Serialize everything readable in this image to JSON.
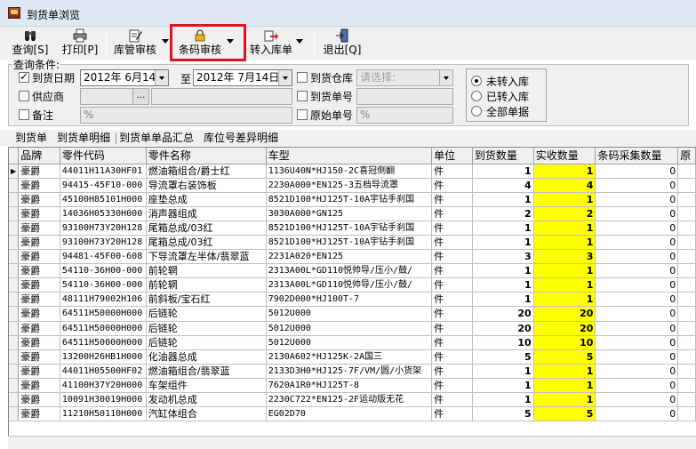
{
  "window": {
    "title": "到货单浏览"
  },
  "toolbar": {
    "query": "查询[S]",
    "print": "打印[P]",
    "warehouse_review": "库管审核",
    "barcode_review": "条码审核",
    "stock_in": "转入库单",
    "exit": "退出[Q]"
  },
  "filter": {
    "legend": "查询条件:",
    "arrival_date_label": "到货日期",
    "date_from": "2012年 6月14日",
    "to_label": "至",
    "date_to": "2012年 7月14日",
    "warehouse_label": "到货仓库",
    "warehouse_placeholder": "请选择:",
    "supplier_label": "供应商",
    "ellipsis": "...",
    "arrival_no_label": "到货单号",
    "remark_label": "备注",
    "remark_value": "%",
    "original_no_label": "原始单号",
    "original_no_value": "%",
    "radio_not_in": "未转入库",
    "radio_in": "已转入库",
    "radio_all": "全部单据"
  },
  "tabs": [
    "到货单",
    "到货单明细",
    "到货单单品汇总",
    "库位号差异明细"
  ],
  "grid": {
    "columns": [
      "品牌",
      "零件代码",
      "零件名称",
      "车型",
      "单位",
      "到货数量",
      "实收数量",
      "条码采集数量",
      "原"
    ],
    "rows": [
      [
        "豪爵",
        "44011H11A30HF01",
        "燃油箱组合/爵士红",
        "1136U40N*HJ150-2C喜冠侧翻",
        "件",
        "1",
        "1",
        "0"
      ],
      [
        "豪爵",
        "94415-45F10-000",
        "导流罩右装饰板",
        "2230A000*EN125-3五档导流罩",
        "件",
        "4",
        "4",
        "0"
      ],
      [
        "豪爵",
        "45100H85101H000",
        "座垫总成",
        "8521D100*HJ125T-10A宇钻手刹国",
        "件",
        "1",
        "1",
        "0"
      ],
      [
        "豪爵",
        "14036H05330H000",
        "消声器组成",
        "3030A000*GN125",
        "件",
        "2",
        "2",
        "0"
      ],
      [
        "豪爵",
        "93100H73Y20H128",
        "尾箱总成/03红",
        "8521D100*HJ125T-10A宇钻手刹国",
        "件",
        "1",
        "1",
        "0"
      ],
      [
        "豪爵",
        "93100H73Y20H128",
        "尾箱总成/03红",
        "8521D100*HJ125T-10A宇钻手刹国",
        "件",
        "1",
        "1",
        "0"
      ],
      [
        "豪爵",
        "94481-45F00-608",
        "下导流罩左半体/翡翠蓝",
        "2231A020*EN125",
        "件",
        "3",
        "3",
        "0"
      ],
      [
        "豪爵",
        "54110-36H00-000",
        "前轮辋",
        "2313A00L*GD110悦帅导/压小/鼓/",
        "件",
        "1",
        "1",
        "0"
      ],
      [
        "豪爵",
        "54110-36H00-000",
        "前轮辋",
        "2313A00L*GD110悦帅导/压小/鼓/",
        "件",
        "1",
        "1",
        "0"
      ],
      [
        "豪爵",
        "48111H79002H106",
        "前斜板/宝石红",
        "7902D000*HJ100T-7",
        "件",
        "1",
        "1",
        "0"
      ],
      [
        "豪爵",
        "64511H50000H000",
        "后链轮",
        "5012U000",
        "件",
        "20",
        "20",
        "0"
      ],
      [
        "豪爵",
        "64511H50000H000",
        "后链轮",
        "5012U000",
        "件",
        "20",
        "20",
        "0"
      ],
      [
        "豪爵",
        "64511H50000H000",
        "后链轮",
        "5012U000",
        "件",
        "10",
        "10",
        "0"
      ],
      [
        "豪爵",
        "13200H26HB1H000",
        "化油器总成",
        "2130A602*HJ125K-2A国三",
        "件",
        "5",
        "5",
        "0"
      ],
      [
        "豪爵",
        "44011H05500HF02",
        "燃油箱组合/翡翠蓝",
        "2133D3H0*HJ125-7F/VM/圆/小货架",
        "件",
        "1",
        "1",
        "0"
      ],
      [
        "豪爵",
        "41100H37Y20H000",
        "车架组件",
        "7620A1R0*HJ125T-8",
        "件",
        "1",
        "1",
        "0"
      ],
      [
        "豪爵",
        "10091H30019H000",
        "发动机总成",
        "2230C722*EN125-2F运动版无花",
        "件",
        "1",
        "1",
        "0"
      ],
      [
        "豪爵",
        "11210H50110H000",
        "汽缸体组合",
        "EG02D70",
        "件",
        "5",
        "5",
        "0"
      ]
    ]
  },
  "colors": {
    "highlight": "#ffff00",
    "annotation_box": "#e0141e"
  }
}
